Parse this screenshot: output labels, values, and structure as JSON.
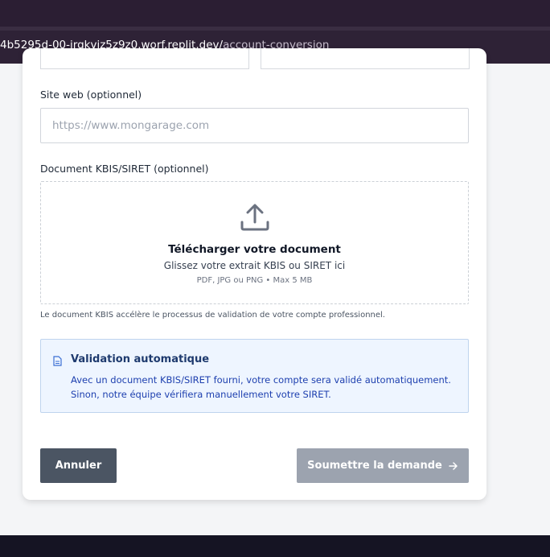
{
  "browser": {
    "url_host": "4b5295d-00-irqkvjz5z9z0.worf.replit.dev/",
    "url_path": "account-conversion"
  },
  "form": {
    "website": {
      "label": "Site web (optionnel)",
      "placeholder": "https://www.mongarage.com",
      "value": ""
    },
    "document": {
      "label": "Document KBIS/SIRET (optionnel)",
      "upload_icon": "upload-icon",
      "title": "Télécharger votre document",
      "subtitle": "Glissez votre extrait KBIS ou SIRET ici",
      "formats": "PDF, JPG ou PNG • Max 5 MB",
      "helper": "Le document KBIS accélère le processus de validation de votre compte professionnel."
    },
    "info": {
      "icon": "document-icon",
      "title": "Validation automatique",
      "line1": "Avec un document KBIS/SIRET fourni, votre compte sera validé automatiquement.",
      "line2": "Sinon, notre équipe vérifiera manuellement votre SIRET."
    },
    "actions": {
      "cancel_label": "Annuler",
      "submit_label": "Soumettre la demande",
      "submit_icon": "arrow-right-icon"
    }
  },
  "colors": {
    "cancel_button": "#4b5563",
    "submit_button_disabled": "#9ca3af",
    "info_background": "#eef5ff",
    "info_text": "#1e40af"
  }
}
